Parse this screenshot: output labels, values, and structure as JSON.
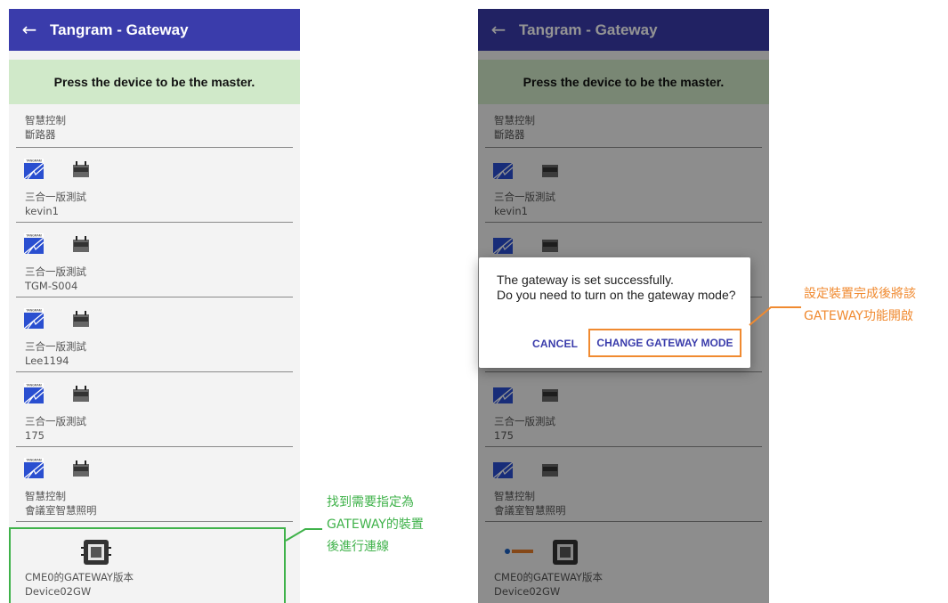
{
  "app": {
    "title": "Tangram - Gateway"
  },
  "banner": "Press the device to be the master.",
  "devices": [
    {
      "line1": "智慧控制",
      "line2": "斷路器"
    },
    {
      "line1": "三合一版測試",
      "line2": "kevin1"
    },
    {
      "line1": "三合一版測試",
      "line2": "TGM-S004"
    },
    {
      "line1": "三合一版測試",
      "line2": "Lee1194"
    },
    {
      "line1": "三合一版測試",
      "line2": "175"
    },
    {
      "line1": "智慧控制",
      "line2": "會議室智慧照明"
    }
  ],
  "gateway_item": {
    "line1": "CME0的GATEWAY版本",
    "line2": "Device02GW"
  },
  "dialog": {
    "message": "The gateway is set successfully.\nDo you need to turn on the gateway mode?",
    "cancel_label": "CANCEL",
    "confirm_label": "CHANGE GATEWAY MODE"
  },
  "annotations": {
    "green_note": "找到需要指定為\nGATEWAY的裝置\n後進行連線",
    "orange_note": "設定裝置完成後將該\nGATEWAY功能開啟"
  },
  "colors": {
    "appbar": "#3a3cab",
    "banner": "#d0e9c9",
    "green_annotation": "#3fb24a",
    "orange_annotation": "#f08a30"
  },
  "icons": [
    "back-arrow-icon",
    "tangram-logo-icon",
    "controller-device-icon",
    "gateway-device-icon"
  ]
}
